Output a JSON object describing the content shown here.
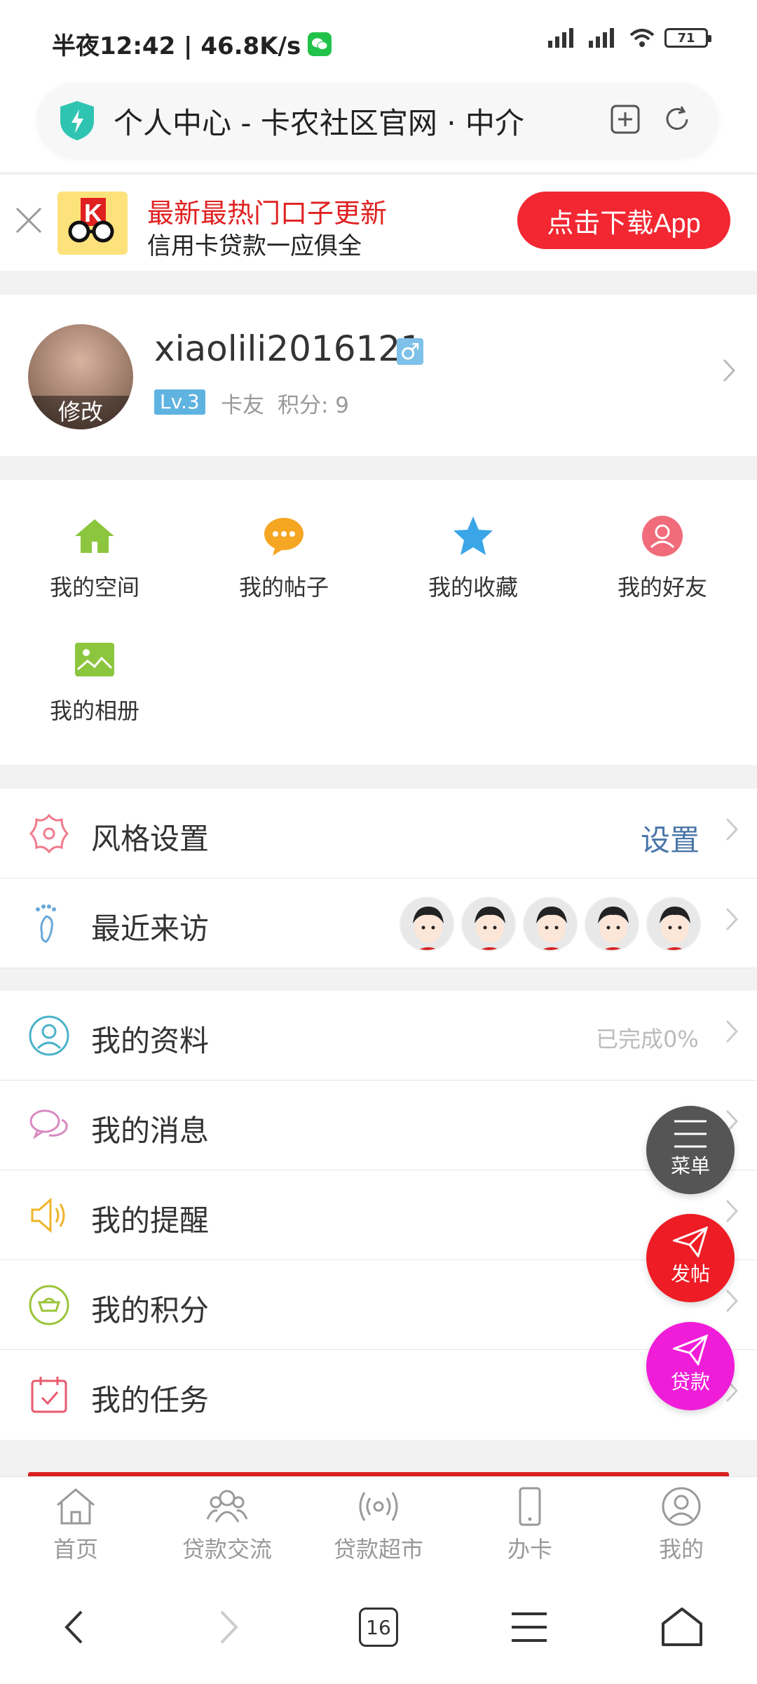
{
  "status_bar": {
    "time": "半夜12:42 | 46.8K/s",
    "battery": "71"
  },
  "url_bar": {
    "title": "个人中心 - 卡农社区官网 · 中介"
  },
  "promo": {
    "title": "最新最热门口子更新",
    "subtitle": "信用卡贷款一应俱全",
    "button": "点击下载App",
    "logo_letter": "K"
  },
  "profile": {
    "username": "xiaolili2016121",
    "gender": "♂",
    "avatar_edit": "修改",
    "level": "Lv.3",
    "rank": "卡友",
    "score": "积分: 9"
  },
  "quick_links": [
    {
      "label": "我的空间",
      "icon": "home-icon",
      "color": "#8cc63f"
    },
    {
      "label": "我的帖子",
      "icon": "chat-icon",
      "color": "#f5a623"
    },
    {
      "label": "我的收藏",
      "icon": "star-icon",
      "color": "#3aa6e8"
    },
    {
      "label": "我的好友",
      "icon": "friend-icon",
      "color": "#f06c7b"
    },
    {
      "label": "我的相册",
      "icon": "album-icon",
      "color": "#8cc63f"
    }
  ],
  "settings": {
    "style": {
      "label": "风格设置",
      "action": "设置"
    },
    "visitors": {
      "label": "最近来访"
    }
  },
  "menu": {
    "profile": {
      "label": "我的资料",
      "hint": "已完成0%"
    },
    "messages": {
      "label": "我的消息"
    },
    "reminders": {
      "label": "我的提醒"
    },
    "points": {
      "label": "我的积分"
    },
    "tasks": {
      "label": "我的任务"
    }
  },
  "fabs": {
    "menu": "菜单",
    "post": "发帖",
    "loan": "贷款"
  },
  "tabbar": [
    {
      "label": "首页",
      "icon": "home-outline-icon"
    },
    {
      "label": "贷款交流",
      "icon": "people-icon"
    },
    {
      "label": "贷款超市",
      "icon": "broadcast-icon"
    },
    {
      "label": "办卡",
      "icon": "phone-icon"
    },
    {
      "label": "我的",
      "icon": "user-icon"
    }
  ],
  "browser_nav": {
    "tab_count": "16"
  },
  "colors": {
    "accent_red": "#f22732",
    "link_blue": "#4a76a8",
    "fab_menu": "#555555",
    "fab_post": "#ee1c25",
    "fab_loan": "#f01dd8"
  }
}
